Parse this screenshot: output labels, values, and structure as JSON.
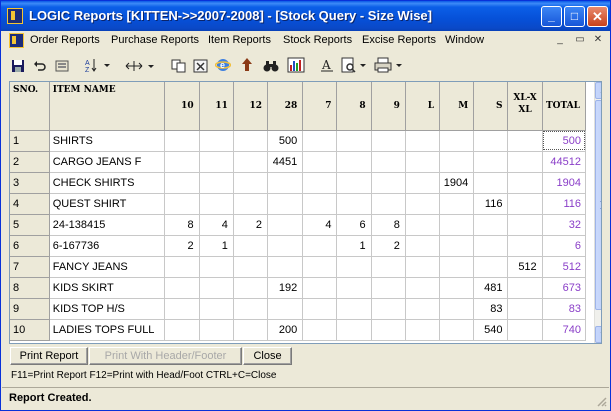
{
  "window": {
    "title": "LOGIC Reports  [KITTEN->>2007-2008] - [Stock Query - Size Wise]",
    "minimize": "_",
    "maximize": "□",
    "close": "✕"
  },
  "menubar": {
    "items": [
      "Order Reports",
      "Purchase Reports",
      "Item Reports",
      "Stock Reports",
      "Excise Reports",
      "Window"
    ],
    "mdi_controls": [
      "_",
      "▭",
      "✕"
    ]
  },
  "toolbar": {
    "icons": [
      "save-icon",
      "undo-icon",
      "print-preview-icon",
      "sort-icon",
      "column-width-icon",
      "copy-icon",
      "excel-icon",
      "internet-icon",
      "upload-icon",
      "find-icon",
      "chart-icon",
      "font-icon",
      "page-setup-icon",
      "printer-icon"
    ]
  },
  "grid": {
    "columns": [
      "SNO.",
      "ITEM NAME",
      "10",
      "11",
      "12",
      "28",
      "7",
      "8",
      "9",
      "L",
      "M",
      "S",
      "XL-X XL",
      "TOTAL"
    ],
    "rows": [
      {
        "sno": "1",
        "item": "SHIRTS",
        "c10": "",
        "c11": "",
        "c12": "",
        "c28": "500",
        "c7": "",
        "c8": "",
        "c9": "",
        "L": "",
        "M": "",
        "S": "",
        "XL": "",
        "total": "500"
      },
      {
        "sno": "2",
        "item": "CARGO JEANS F",
        "c10": "",
        "c11": "",
        "c12": "",
        "c28": "4451",
        "c7": "",
        "c8": "",
        "c9": "",
        "L": "",
        "M": "",
        "S": "",
        "XL": "",
        "total": "44512"
      },
      {
        "sno": "3",
        "item": "CHECK SHIRTS",
        "c10": "",
        "c11": "",
        "c12": "",
        "c28": "",
        "c7": "",
        "c8": "",
        "c9": "",
        "L": "",
        "M": "1904",
        "S": "",
        "XL": "",
        "total": "1904"
      },
      {
        "sno": "4",
        "item": "QUEST SHIRT",
        "c10": "",
        "c11": "",
        "c12": "",
        "c28": "",
        "c7": "",
        "c8": "",
        "c9": "",
        "L": "",
        "M": "",
        "S": "116",
        "XL": "",
        "total": "116"
      },
      {
        "sno": "5",
        "item": "24-138415",
        "c10": "8",
        "c11": "4",
        "c12": "2",
        "c28": "",
        "c7": "4",
        "c8": "6",
        "c9": "8",
        "L": "",
        "M": "",
        "S": "",
        "XL": "",
        "total": "32"
      },
      {
        "sno": "6",
        "item": "6-167736",
        "c10": "2",
        "c11": "1",
        "c12": "",
        "c28": "",
        "c7": "",
        "c8": "1",
        "c9": "2",
        "L": "",
        "M": "",
        "S": "",
        "XL": "",
        "total": "6"
      },
      {
        "sno": "7",
        "item": "FANCY JEANS",
        "c10": "",
        "c11": "",
        "c12": "",
        "c28": "",
        "c7": "",
        "c8": "",
        "c9": "",
        "L": "",
        "M": "",
        "S": "",
        "XL": "512",
        "total": "512"
      },
      {
        "sno": "8",
        "item": "KIDS SKIRT",
        "c10": "",
        "c11": "",
        "c12": "",
        "c28": "192",
        "c7": "",
        "c8": "",
        "c9": "",
        "L": "",
        "M": "",
        "S": "481",
        "XL": "",
        "total": "673"
      },
      {
        "sno": "9",
        "item": "KIDS TOP H/S",
        "c10": "",
        "c11": "",
        "c12": "",
        "c28": "",
        "c7": "",
        "c8": "",
        "c9": "",
        "L": "",
        "M": "",
        "S": "83",
        "XL": "",
        "total": "83"
      },
      {
        "sno": "10",
        "item": "LADIES TOPS FULL",
        "c10": "",
        "c11": "",
        "c12": "",
        "c28": "200",
        "c7": "",
        "c8": "",
        "c9": "",
        "L": "",
        "M": "",
        "S": "540",
        "XL": "",
        "total": "740"
      }
    ]
  },
  "buttons": {
    "print_report": "Print Report",
    "print_with_header": "Print With Header/Footer",
    "close": "Close"
  },
  "hint": "F11=Print Report  F12=Print with Head/Foot  CTRL+C=Close",
  "status": "Report Created.",
  "colors": {
    "total_text": "#8a3ec8",
    "titlebar": "#0650d8"
  }
}
